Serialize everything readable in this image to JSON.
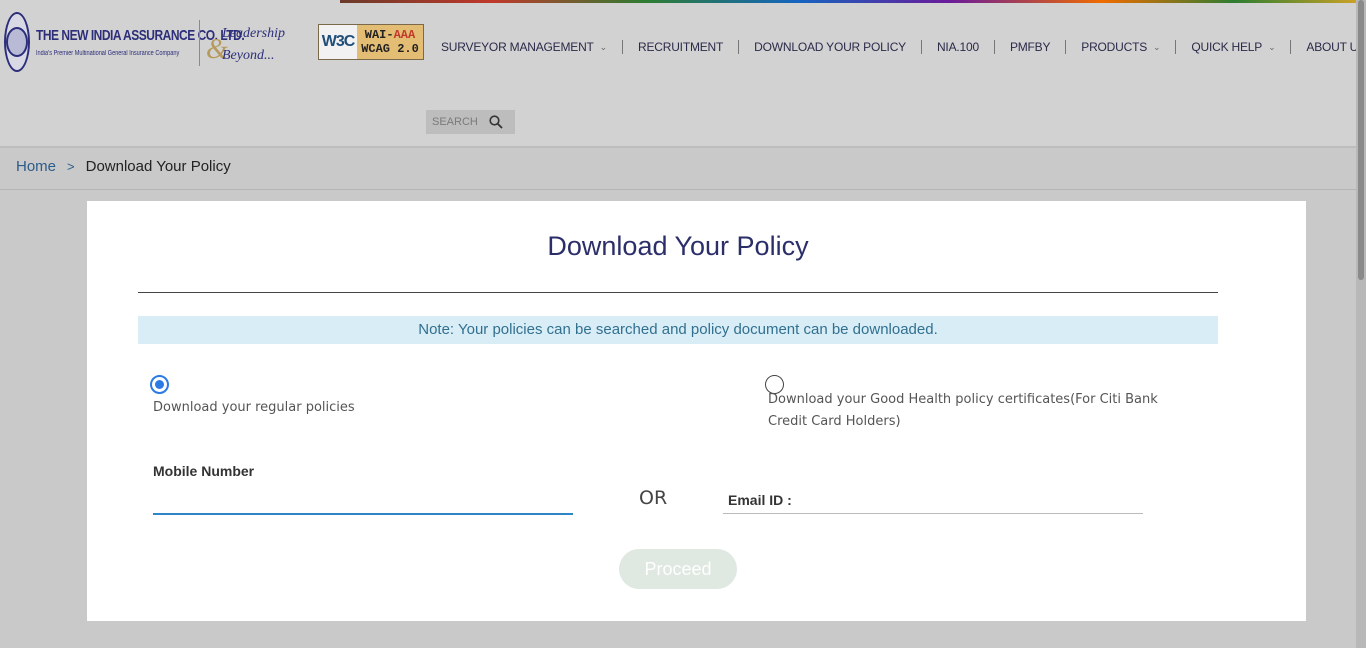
{
  "header": {
    "logo": {
      "title": "THE NEW INDIA ASSURANCE CO. LTD.",
      "subtitle": "India's Premier Multinational General Insurance Company"
    },
    "tagline": {
      "line1": "Leadership",
      "line2": "Beyond..."
    },
    "accessibility_badge": {
      "w3c": "W3C",
      "level": "WAI-AAA",
      "standard": "WCAG 2.0"
    },
    "nav": [
      {
        "label": "SURVEYOR MANAGEMENT",
        "has_dropdown": true
      },
      {
        "label": "RECRUITMENT",
        "has_dropdown": false
      },
      {
        "label": "DOWNLOAD YOUR POLICY",
        "has_dropdown": false
      },
      {
        "label": "NIA.100",
        "has_dropdown": false
      },
      {
        "label": "PMFBY",
        "has_dropdown": false
      },
      {
        "label": "PRODUCTS",
        "has_dropdown": true
      },
      {
        "label": "QUICK HELP",
        "has_dropdown": true
      },
      {
        "label": "ABOUT US",
        "has_dropdown": true
      }
    ],
    "search": {
      "placeholder": "SEARCH"
    }
  },
  "breadcrumb": {
    "home": "Home",
    "separator": ">",
    "current": "Download Your Policy"
  },
  "card": {
    "title": "Download Your Policy",
    "note": "Note: Your policies can be searched and policy document can be downloaded.",
    "options": {
      "regular": {
        "label": "Download your regular policies",
        "checked": true
      },
      "good_health": {
        "label": "Download your Good Health policy certificates(For Citi Bank Credit Card Holders)",
        "checked": false
      }
    },
    "mobile_label": "Mobile Number",
    "or_text": "OR",
    "email_label": "Email ID :",
    "proceed_label": "Proceed"
  },
  "colors": {
    "accent": "#2b7be4",
    "title_navy": "#2c2e6a",
    "note_bg": "#d9edf7",
    "note_text": "#31708f",
    "mobile_underline": "#2f86c6",
    "email_underline": "#bbbbbb",
    "proceed_bg": "#dfe8e1"
  }
}
